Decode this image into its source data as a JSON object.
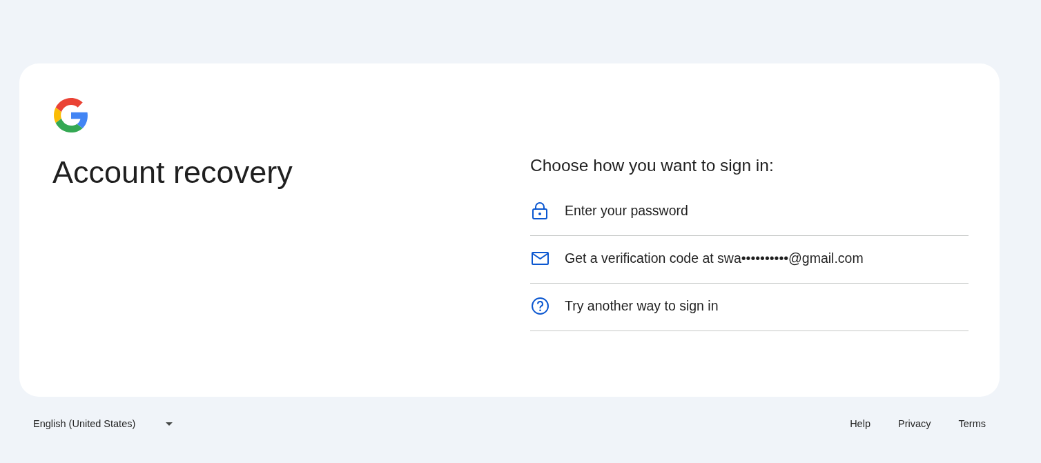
{
  "title": "Account recovery",
  "prompt": "Choose how you want to sign in:",
  "options": [
    {
      "kind": "password",
      "label": "Enter your password"
    },
    {
      "kind": "email",
      "label": "Get a verification code at swa••••••••••@gmail.com"
    },
    {
      "kind": "other",
      "label": "Try another way to sign in"
    }
  ],
  "footer": {
    "language": "English (United States)",
    "links": [
      "Help",
      "Privacy",
      "Terms"
    ]
  }
}
